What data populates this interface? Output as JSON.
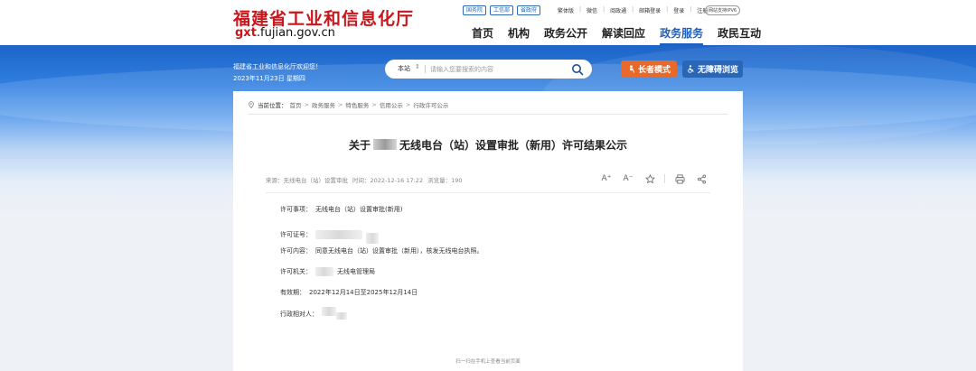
{
  "header": {
    "site_title": "福建省工业和信息化厅",
    "domain_highlight": "gxt",
    "domain_rest": ".fujian.gov.cn",
    "badges": [
      "国务院",
      "工信部",
      "省政府"
    ],
    "top_links": [
      "繁体版",
      "微信",
      "阅政通",
      "邮箱登录",
      "登录",
      "注册"
    ],
    "ipv6": "网站支持IPV6",
    "nav": [
      "首页",
      "机构",
      "政务公开",
      "解读回应",
      "政务服务",
      "政民互动"
    ],
    "nav_active": "政务服务"
  },
  "banner": {
    "welcome": "福建省工业和信息化厅欢迎您！",
    "date": "2023年11月23日 星期四",
    "search_scope": "本站",
    "search_arrow": "⇕",
    "search_placeholder": "请输入您要搜索的内容",
    "elder_mode": "长者模式",
    "accessible_browse": "无障碍浏览"
  },
  "breadcrumb": {
    "label": "当前位置：",
    "items": [
      "首页",
      "政务服务",
      "特色服务",
      "信用公示",
      "行政许可公示"
    ],
    "separator": ">"
  },
  "article": {
    "title_prefix": "关于",
    "title_suffix": "无线电台（站）设置审批（新用）许可结果公示",
    "meta_source": "来源：无线电台（站）设置审批",
    "meta_time": "时间：2022-12-16 17:22",
    "meta_views": "浏览量：190",
    "tools": {
      "font_up": "A⁺",
      "font_down": "A⁻"
    },
    "fields": {
      "item_label": "许可事项：",
      "item_value": "无线电台（站）设置审批(新用)",
      "cert_label": "许可证号：",
      "content_label": "许可内容：",
      "content_value": "同意无线电台（站）设置审批（新用），核发无线电台执照。",
      "authority_label": "许可机关：",
      "authority_value": "无线电管理局",
      "validity_label": "有效期：",
      "validity_value": "2022年12月14日至2025年12月14日",
      "party_label": "行政相对人："
    },
    "footer": "扫一扫在手机上查看当前页面"
  },
  "colors": {
    "brand_red": "#c8161d",
    "nav_blue": "#1f5fbf",
    "elder_orange": "#e8692a",
    "access_blue": "#2a66b6"
  }
}
